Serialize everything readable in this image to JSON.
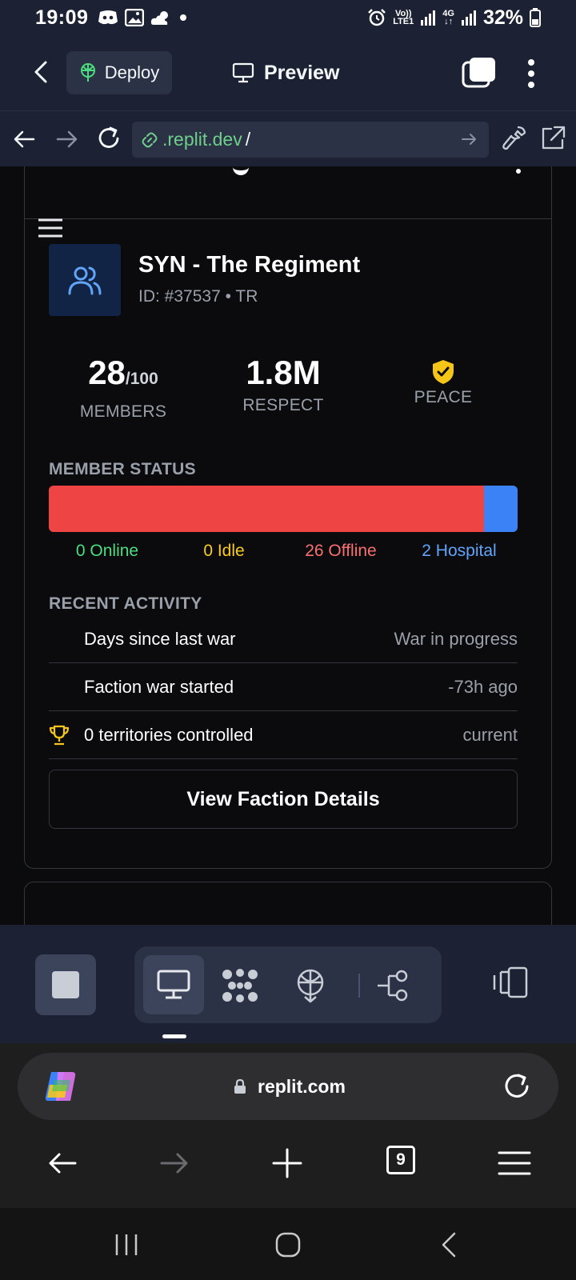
{
  "status_bar": {
    "time": "19:09",
    "net_top": "Vo))",
    "net_bottom": "LTE1",
    "net2_top": "4G",
    "net2_bottom": "↓↑",
    "battery": "32%"
  },
  "replit_header": {
    "deploy_label": "Deploy",
    "preview_label": "Preview"
  },
  "webview": {
    "url": ".replit.dev",
    "url_suffix": "/"
  },
  "faction": {
    "name": "SYN - The Regiment",
    "id_line": "ID: #37537 • TR",
    "members_value": "28",
    "members_max": "/100",
    "members_label": "MEMBERS",
    "respect_value": "1.8M",
    "respect_label": "RESPECT",
    "state_label": "PEACE"
  },
  "member_status": {
    "title": "MEMBER STATUS",
    "total": 28,
    "segments": [
      {
        "key": "online",
        "count": 0,
        "color": "#22c55e"
      },
      {
        "key": "idle",
        "count": 0,
        "color": "#facc15"
      },
      {
        "key": "offline",
        "count": 26,
        "color": "#ef4444"
      },
      {
        "key": "hospital",
        "count": 2,
        "color": "#3b82f6"
      }
    ],
    "legend": {
      "online": "0 Online",
      "idle": "0 Idle",
      "offline": "26 Offline",
      "hospital": "2 Hospital"
    },
    "legend_colors": {
      "online": "#4ade80",
      "idle": "#facc15",
      "offline": "#f87171",
      "hospital": "#60a5fa"
    }
  },
  "recent_activity": {
    "title": "RECENT ACTIVITY",
    "rows": [
      {
        "label": "Days since last war",
        "value": "War in progress"
      },
      {
        "label": "Faction war started",
        "value": "-73h ago"
      },
      {
        "label": "0 territories controlled",
        "value": "current",
        "icon": "trophy-icon"
      }
    ]
  },
  "view_details_label": "View Faction Details",
  "browser": {
    "domain": "replit.com",
    "tab_count": "9"
  },
  "colors": {
    "chrome_bg": "#1c2233",
    "page_bg": "#0b0b0d",
    "accent_green": "#6fcf8a",
    "peace_gold": "#f5c518"
  }
}
